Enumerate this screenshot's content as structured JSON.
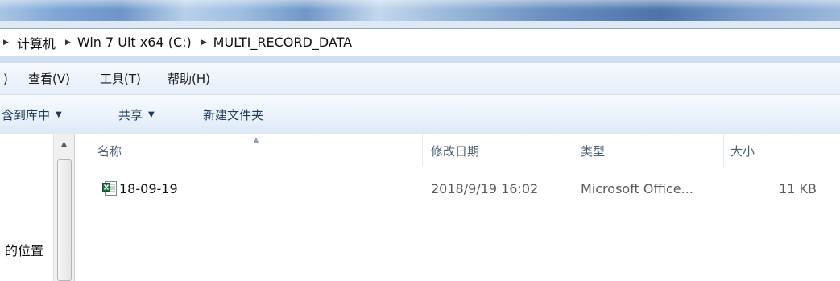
{
  "breadcrumbs": [
    {
      "label": "计算机"
    },
    {
      "label": "Win 7 Ult x64 (C:)"
    },
    {
      "label": "MULTI_RECORD_DATA"
    }
  ],
  "menubar": {
    "partial": ")",
    "items": [
      {
        "label": "查看(V)"
      },
      {
        "label": "工具(T)"
      },
      {
        "label": "帮助(H)"
      }
    ]
  },
  "toolbar": {
    "include_in_library": "含到库中",
    "share": "共享",
    "new_folder": "新建文件夹"
  },
  "nav": {
    "location_label": "的位置"
  },
  "columns": {
    "name": "名称",
    "date_modified": "修改日期",
    "type": "类型",
    "size": "大小"
  },
  "files": [
    {
      "name": "18-09-19",
      "date_modified": "2018/9/19 16:02",
      "type": "Microsoft Office...",
      "size": "11 KB",
      "icon": "excel-file-icon"
    }
  ],
  "colors": {
    "accent": "#1e395b",
    "header_text": "#4c607a",
    "excel_green": "#1e7145"
  }
}
